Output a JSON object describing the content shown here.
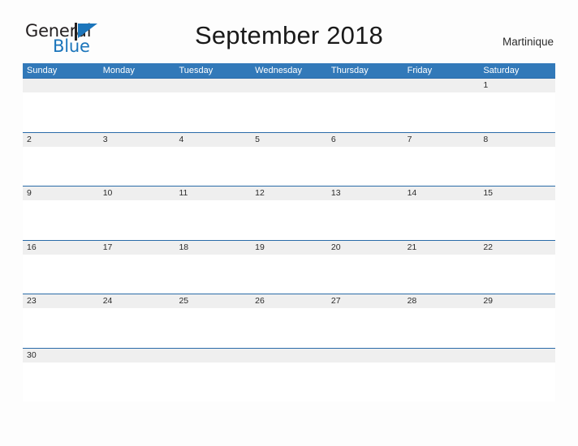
{
  "brand": {
    "name_part_1": "General",
    "name_part_2": "Blue",
    "flag_icon": "blue-flag-triangle",
    "dark_color": "#231f20",
    "blue_color": "#1b75bb"
  },
  "header": {
    "title": "September 2018",
    "locale": "Martinique"
  },
  "theme": {
    "header_blue": "#3279b9",
    "row_rule_blue": "#2a6ba8",
    "date_band_gray": "#efefef",
    "page_background": "#fdfdfd"
  },
  "calendar": {
    "weekdays": [
      "Sunday",
      "Monday",
      "Tuesday",
      "Wednesday",
      "Thursday",
      "Friday",
      "Saturday"
    ],
    "weeks": [
      [
        "",
        "",
        "",
        "",
        "",
        "",
        "1"
      ],
      [
        "2",
        "3",
        "4",
        "5",
        "6",
        "7",
        "8"
      ],
      [
        "9",
        "10",
        "11",
        "12",
        "13",
        "14",
        "15"
      ],
      [
        "16",
        "17",
        "18",
        "19",
        "20",
        "21",
        "22"
      ],
      [
        "23",
        "24",
        "25",
        "26",
        "27",
        "28",
        "29"
      ],
      [
        "30",
        "",
        "",
        "",
        "",
        "",
        ""
      ]
    ]
  }
}
